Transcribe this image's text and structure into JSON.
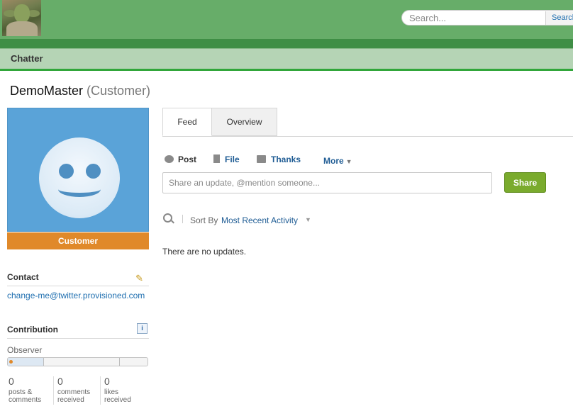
{
  "header": {
    "search_placeholder": "Search...",
    "search_button": "Search"
  },
  "nav": {
    "tab_label": "Chatter"
  },
  "profile": {
    "name": "DemoMaster",
    "role_suffix": "(Customer)",
    "badge": "Customer"
  },
  "contact": {
    "title": "Contact",
    "email": "change-me@twitter.provisioned.com"
  },
  "contribution": {
    "title": "Contribution",
    "info_icon": "i",
    "level": "Observer",
    "progress_fraction": 0.26,
    "stats": [
      {
        "num": "0",
        "label1": "posts &",
        "label2": "comments"
      },
      {
        "num": "0",
        "label1": "comments",
        "label2": "received"
      },
      {
        "num": "0",
        "label1": "likes",
        "label2": "received"
      }
    ]
  },
  "feed_tabs": {
    "feed": "Feed",
    "overview": "Overview"
  },
  "publisher": {
    "post": "Post",
    "file": "File",
    "thanks": "Thanks",
    "more": "More",
    "placeholder": "Share an update, @mention someone...",
    "share": "Share"
  },
  "feed": {
    "sort_label": "Sort By",
    "sort_value": "Most Recent Activity",
    "empty_text": "There are no updates."
  },
  "colors": {
    "topbar": "#67ad69",
    "badge": "#e0892a",
    "share": "#7aab2d",
    "link": "#1f6fb0"
  }
}
